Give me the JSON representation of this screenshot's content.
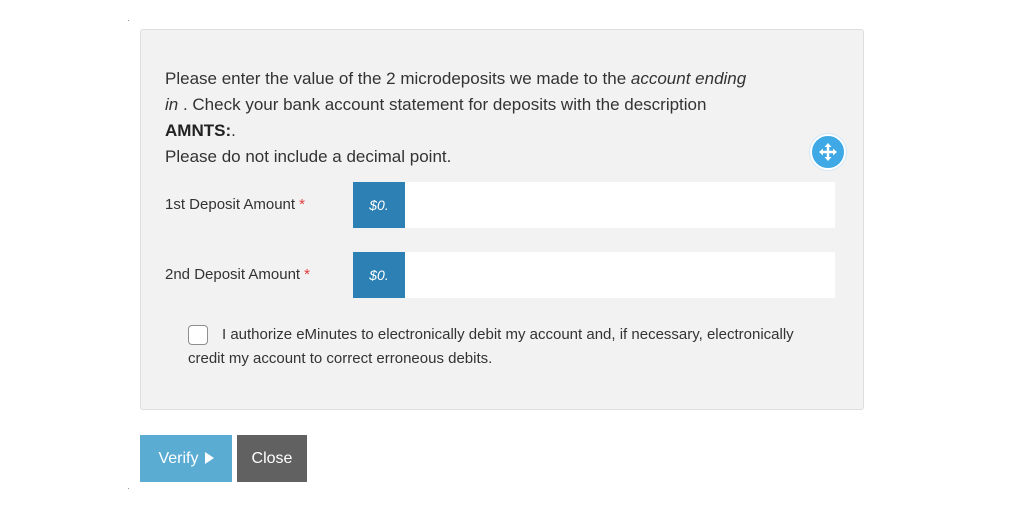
{
  "instructions": {
    "line1_pre": "Please enter the value of the 2 microdeposits we made to the ",
    "line1_em": "account ending",
    "line2_em": "in",
    "line2_post": " . Check your bank account statement for deposits with the description",
    "line3_bold": "AMNTS:",
    "line3_post": ".",
    "line4": "Please do not include a decimal point."
  },
  "fields": [
    {
      "label": "1st Deposit Amount",
      "required_mark": "*",
      "prefix": "$0.",
      "value": ""
    },
    {
      "label": "2nd Deposit Amount",
      "required_mark": "*",
      "prefix": "$0.",
      "value": ""
    }
  ],
  "authorization": {
    "checked": false,
    "text": "I authorize eMinutes to electronically debit my account and, if necessary, electronically credit my account to correct erroneous debits."
  },
  "buttons": {
    "verify": "Verify",
    "close": "Close"
  },
  "icons": {
    "move": "move-arrows-icon",
    "verify_arrow": "play-arrow-icon"
  },
  "colors": {
    "addon": "#2c80b4",
    "verify": "#5aacd3",
    "close": "#616161",
    "move_button": "#3fa9e6",
    "required": "#e23b3b"
  }
}
